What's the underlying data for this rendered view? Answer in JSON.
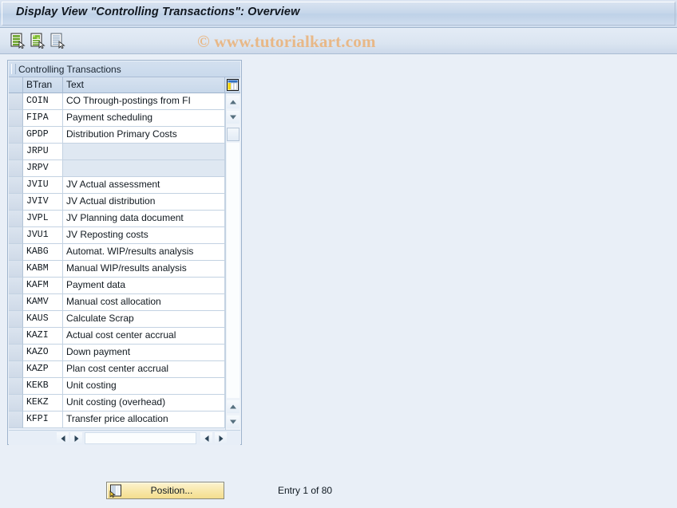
{
  "window": {
    "title": "Display View \"Controlling Transactions\": Overview"
  },
  "watermark": {
    "text": "© www.tutorialkart.com",
    "color": "#e8b887"
  },
  "toolbar": {
    "buttons": [
      {
        "name": "display-details-icon",
        "tooltip": "Details"
      },
      {
        "name": "new-entries-icon",
        "tooltip": "New Entries"
      },
      {
        "name": "display-list-icon",
        "tooltip": "Display"
      }
    ]
  },
  "panel": {
    "title": "Controlling Transactions",
    "config_icon": "table-settings-icon"
  },
  "table": {
    "columns": [
      "BTran",
      "Text"
    ],
    "rows": [
      {
        "btran": "COIN",
        "text": "CO Through-postings from FI"
      },
      {
        "btran": "FIPA",
        "text": "Payment scheduling"
      },
      {
        "btran": "GPDP",
        "text": "Distribution Primary Costs"
      },
      {
        "btran": "JRPU",
        "text": ""
      },
      {
        "btran": "JRPV",
        "text": ""
      },
      {
        "btran": "JVIU",
        "text": "JV Actual assessment"
      },
      {
        "btran": "JVIV",
        "text": "JV Actual distribution"
      },
      {
        "btran": "JVPL",
        "text": "JV Planning data document"
      },
      {
        "btran": "JVU1",
        "text": "JV Reposting costs"
      },
      {
        "btran": "KABG",
        "text": "Automat. WIP/results analysis"
      },
      {
        "btran": "KABM",
        "text": "Manual WIP/results analysis"
      },
      {
        "btran": "KAFM",
        "text": "Payment data"
      },
      {
        "btran": "KAMV",
        "text": "Manual cost allocation"
      },
      {
        "btran": "KAUS",
        "text": "Calculate Scrap"
      },
      {
        "btran": "KAZI",
        "text": "Actual cost center accrual"
      },
      {
        "btran": "KAZO",
        "text": "Down payment"
      },
      {
        "btran": "KAZP",
        "text": "Plan cost center accrual"
      },
      {
        "btran": "KEKB",
        "text": "Unit costing"
      },
      {
        "btran": "KEKZ",
        "text": "Unit costing (overhead)"
      },
      {
        "btran": "KFPI",
        "text": "Transfer price allocation"
      }
    ]
  },
  "scrollbars": {
    "vertical": {
      "scroll_up_top": "scroll-up-icon",
      "scroll_down_top": "scroll-down-icon",
      "scroll_up_bottom": "scroll-up-icon",
      "scroll_down_bottom": "scroll-down-icon"
    },
    "horizontal": {
      "left_1": "scroll-left-icon",
      "right_1": "scroll-right-icon",
      "left_2": "scroll-left-icon",
      "right_2": "scroll-right-icon"
    }
  },
  "footer": {
    "position_button": "Position...",
    "position_icon": "position-icon",
    "entry_status": "Entry 1 of 80"
  }
}
